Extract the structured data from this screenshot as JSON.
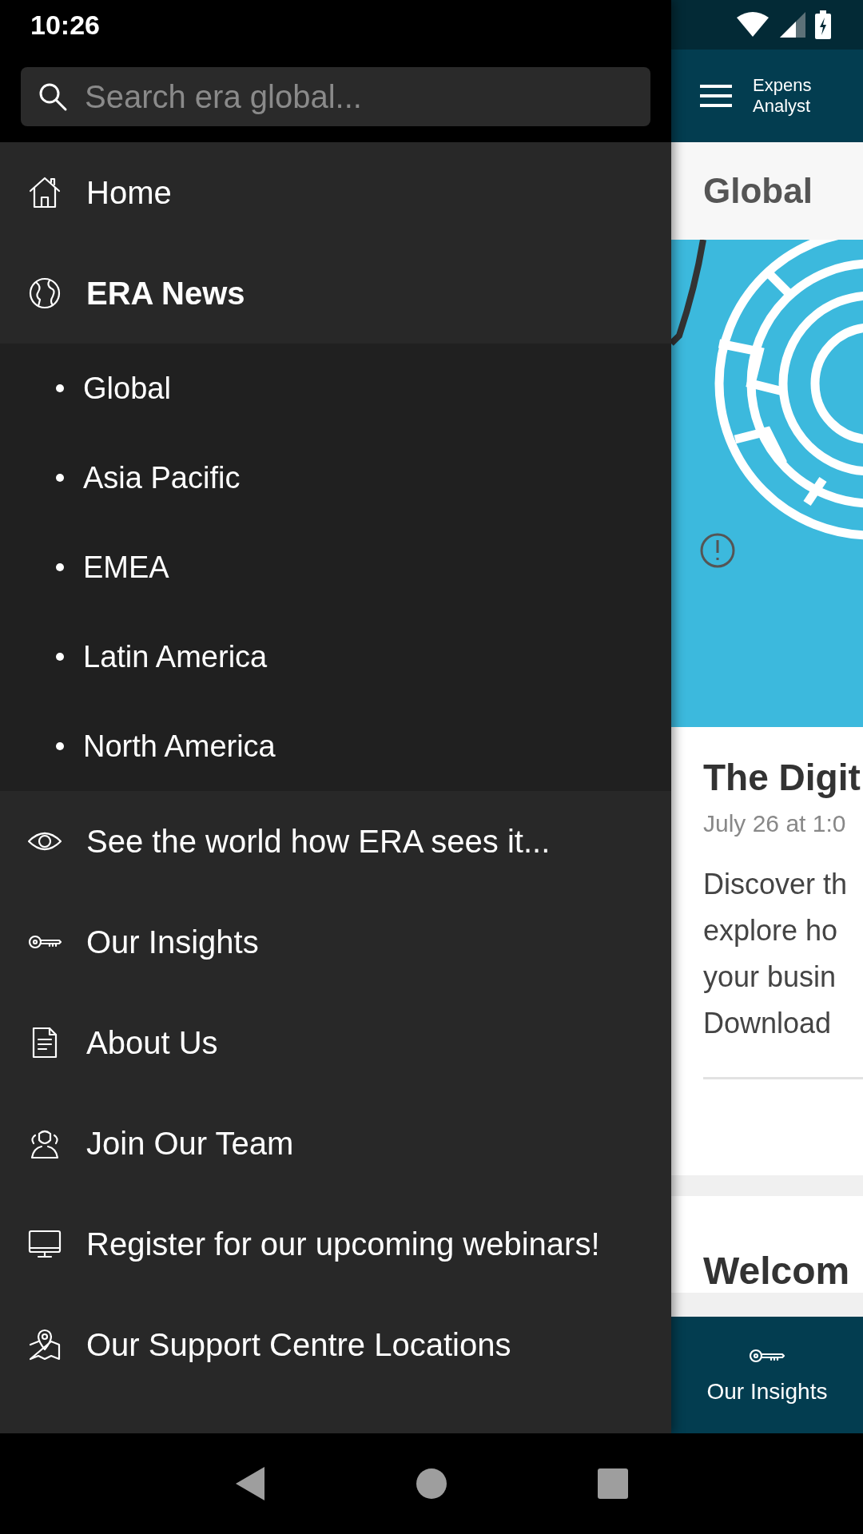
{
  "status_bar": {
    "time": "10:26"
  },
  "search": {
    "placeholder": "Search era global..."
  },
  "menu": [
    {
      "label": "Home",
      "expanded": false
    },
    {
      "label": "ERA News",
      "expanded": true,
      "children": [
        {
          "label": "Global"
        },
        {
          "label": "Asia Pacific"
        },
        {
          "label": "EMEA"
        },
        {
          "label": "Latin America"
        },
        {
          "label": "North America"
        }
      ]
    },
    {
      "label": "See the world how ERA sees it...",
      "expanded": false
    },
    {
      "label": "Our Insights",
      "expanded": false
    },
    {
      "label": "About Us",
      "expanded": false
    },
    {
      "label": "Join Our Team",
      "expanded": false
    },
    {
      "label": "Register for our upcoming webinars!",
      "expanded": false
    },
    {
      "label": "Our Support Centre Locations",
      "expanded": false
    }
  ],
  "app_bar": {
    "brand_line_1": "Expens",
    "brand_line_2": "Analyst"
  },
  "page_title": "Global",
  "article": {
    "title": "The Digit",
    "date": "July 26 at 1:0",
    "excerpt": "Discover th\nexplore ho\nyour busin\nDownload"
  },
  "next_card": {
    "title": "Welcom"
  },
  "bottom_tab": {
    "label": "Our Insights"
  }
}
